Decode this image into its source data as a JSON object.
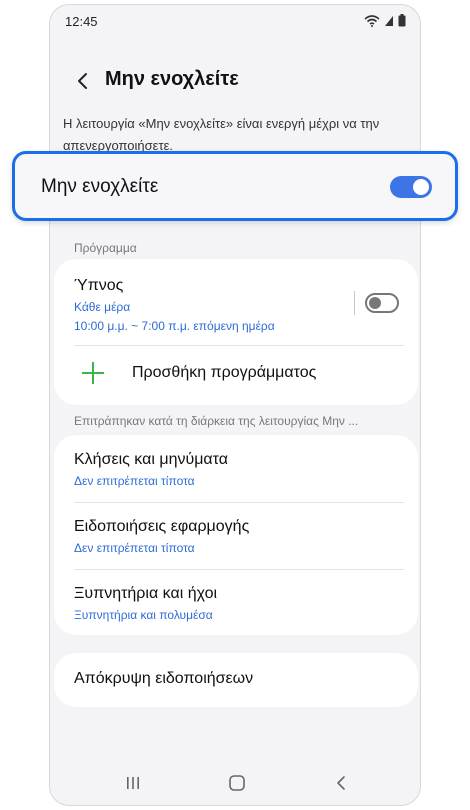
{
  "status_bar": {
    "time": "12:45",
    "icons": [
      "wifi-icon",
      "signal-icon",
      "battery-icon"
    ]
  },
  "header": {
    "title": "Μην ενοχλείτε",
    "back_icon": "chevron-left-icon"
  },
  "description": "Η λειτουργία «Μην ενοχλείτε» είναι ενεργή μέχρι να την απενεργοποιήσετε.",
  "dnd_toggle": {
    "label": "Μην ενοχλείτε",
    "state": "on"
  },
  "schedule": {
    "section_label": "Πρόγραμμα",
    "items": [
      {
        "title": "Ύπνος",
        "days": "Κάθε μέρα",
        "time": "10:00 μ.μ. ~ 7:00 π.μ. επόμενη ημέρα",
        "toggle": "off"
      }
    ],
    "add_label": "Προσθήκη προγράμματος"
  },
  "exceptions": {
    "section_label": "Επιτράπηκαν κατά τη διάρκεια της λειτουργίας Μην ...",
    "items": [
      {
        "title": "Κλήσεις και μηνύματα",
        "subtitle": "Δεν επιτρέπεται τίποτα"
      },
      {
        "title": "Ειδοποιήσεις εφαρμογής",
        "subtitle": "Δεν επιτρέπεται τίποτα"
      },
      {
        "title": "Ξυπνητήρια και ήχοι",
        "subtitle": "Ξυπνητήρια και πολυμέσα"
      }
    ]
  },
  "hide_notifications": {
    "title": "Απόκρυψη ειδοποιήσεων"
  },
  "nav": [
    "recent-apps-icon",
    "home-icon",
    "back-icon"
  ],
  "colors": {
    "accent": "#3e75e6",
    "highlight_border": "#1c6ee8",
    "link": "#2e6bd6",
    "add": "#3bb54a",
    "background": "#f4f4f6"
  }
}
